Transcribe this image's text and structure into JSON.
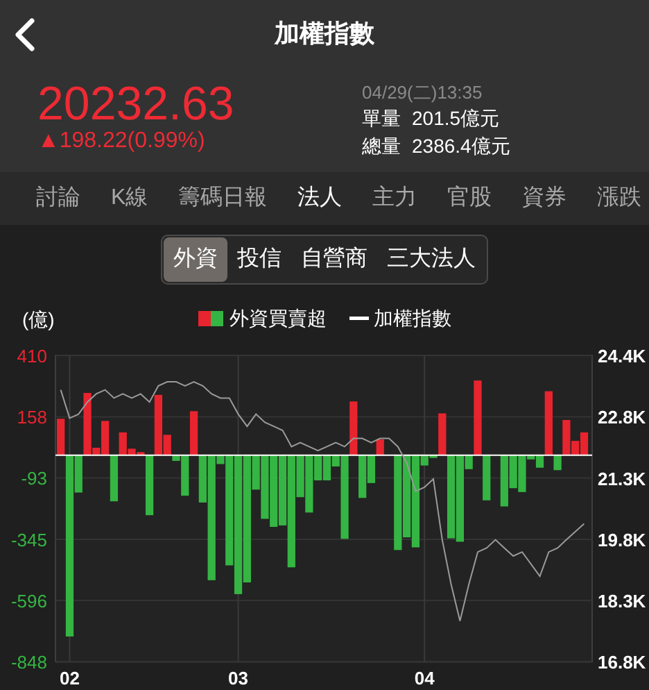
{
  "header": {
    "title": "加權指數"
  },
  "quote": {
    "price": "20232.63",
    "change": "▲198.22(0.99%)",
    "time": "04/29(二)13:35",
    "volume_label": "單量",
    "volume": "201.5億元",
    "total_label": "總量",
    "total": "2386.4億元"
  },
  "tabs": [
    {
      "label": "討論",
      "selected": false
    },
    {
      "label": "K線",
      "selected": false
    },
    {
      "label": "籌碼日報",
      "selected": false
    },
    {
      "label": "法人",
      "selected": true
    },
    {
      "label": "主力",
      "selected": false
    },
    {
      "label": "官股",
      "selected": false
    },
    {
      "label": "資券",
      "selected": false
    },
    {
      "label": "漲跌",
      "selected": false
    }
  ],
  "segments": [
    {
      "label": "外資",
      "selected": true
    },
    {
      "label": "投信",
      "selected": false
    },
    {
      "label": "自營商",
      "selected": false
    },
    {
      "label": "三大法人",
      "selected": false
    }
  ],
  "flows": {
    "unit": "(億)",
    "legend_swatches": [
      {
        "color": "#e8242f"
      },
      {
        "color": "#35b543"
      }
    ],
    "chart_data": {
      "type": "bar",
      "grid": true,
      "categories": [
        null,
        "02",
        null,
        null,
        null,
        null,
        null,
        null,
        null,
        null,
        null,
        null,
        null,
        null,
        null,
        null,
        null,
        null,
        null,
        null,
        "03",
        null,
        null,
        null,
        null,
        null,
        null,
        null,
        null,
        null,
        null,
        null,
        null,
        null,
        null,
        null,
        null,
        null,
        null,
        null,
        null,
        "04",
        null,
        null,
        null,
        null,
        null,
        null,
        null,
        null,
        null,
        null,
        null,
        null,
        null,
        null,
        null,
        null,
        null,
        null
      ],
      "ylim": [
        -848,
        410
      ],
      "yticks": [
        410,
        158,
        -93,
        -345,
        -596,
        -848
      ],
      "series": [
        {
          "name": "外資買賣超",
          "values": [
            150,
            -744,
            -153,
            256,
            31,
            141,
            -189,
            94,
            27,
            13,
            -246,
            248,
            84,
            -23,
            -166,
            181,
            -194,
            -513,
            -36,
            -452,
            -570,
            -522,
            -141,
            -261,
            -294,
            -288,
            -460,
            -172,
            -235,
            -103,
            -103,
            -46,
            -343,
            221,
            -175,
            -114,
            65,
            null,
            -389,
            -337,
            -378,
            -42,
            -11,
            172,
            -341,
            -355,
            -57,
            307,
            -185,
            null,
            -210,
            -135,
            -151,
            -17,
            -51,
            263,
            -61,
            145,
            59,
            94
          ]
        }
      ]
    }
  },
  "index": {
    "chart_data": {
      "type": "line",
      "ylim": [
        16790,
        24350
      ],
      "yticks": [
        {
          "value": 24350,
          "label": "24.4K"
        },
        {
          "value": 22838,
          "label": "22.8K"
        },
        {
          "value": 21326,
          "label": "21.3K"
        },
        {
          "value": 19814,
          "label": "19.8K"
        },
        {
          "value": 18302,
          "label": "18.3K"
        },
        {
          "value": 16790,
          "label": "16.8K"
        }
      ],
      "series": [
        {
          "name": "加權指數",
          "color": "#9a9a9a",
          "values": [
            23500,
            22800,
            22900,
            23200,
            23400,
            23500,
            23300,
            23400,
            23300,
            23400,
            23200,
            23600,
            23700,
            23700,
            23600,
            23700,
            23600,
            23400,
            23300,
            23300,
            22900,
            22600,
            22900,
            22700,
            22600,
            22500,
            22100,
            22200,
            22100,
            22000,
            22100,
            22200,
            22100,
            22300,
            22300,
            22200,
            22300,
            22300,
            22100,
            21700,
            21000,
            21100,
            21300,
            19800,
            18700,
            17800,
            18700,
            19500,
            19600,
            19800,
            19600,
            19400,
            19500,
            19200,
            18900,
            19500,
            19600,
            19800,
            20000,
            20200
          ]
        }
      ]
    }
  }
}
